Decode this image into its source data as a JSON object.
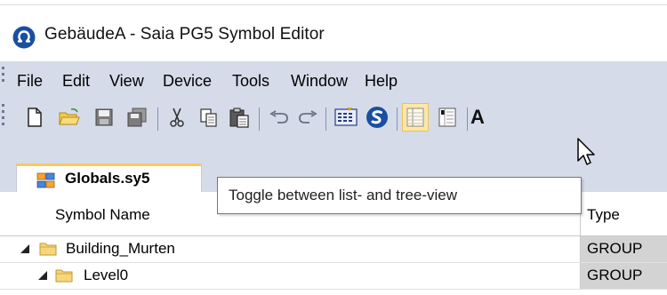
{
  "window": {
    "title": "GebäudeA - Saia PG5 Symbol Editor",
    "icon": "saia-logo-icon"
  },
  "menubar": {
    "items": [
      {
        "label": "File"
      },
      {
        "label": "Edit"
      },
      {
        "label": "View"
      },
      {
        "label": "Device"
      },
      {
        "label": "Tools"
      },
      {
        "label": "Window"
      },
      {
        "label": "Help"
      }
    ]
  },
  "toolbar": {
    "buttons": [
      {
        "icon": "new-document-icon"
      },
      {
        "icon": "open-folder-icon"
      },
      {
        "icon": "save-icon"
      },
      {
        "icon": "save-all-icon"
      },
      {
        "icon": "cut-icon"
      },
      {
        "icon": "copy-icon"
      },
      {
        "icon": "paste-icon"
      },
      {
        "icon": "undo-icon"
      },
      {
        "icon": "redo-icon"
      },
      {
        "icon": "build-icon"
      },
      {
        "icon": "saia-s-icon"
      },
      {
        "icon": "list-view-icon",
        "pressed": true
      },
      {
        "icon": "tree-view-icon"
      },
      {
        "icon": "font-icon",
        "label": "A"
      }
    ]
  },
  "tab": {
    "label": "Globals.sy5",
    "icon": "symbol-file-icon"
  },
  "tooltip": {
    "text": "Toggle between list- and tree-view"
  },
  "grid": {
    "columns": [
      "Symbol Name",
      "Type"
    ],
    "rows": [
      {
        "name": "Building_Murten",
        "type": "GROUP",
        "expanded": true
      },
      {
        "name": "Level0",
        "type": "GROUP",
        "expanded": true
      }
    ]
  },
  "colors": {
    "chrome": "#d6dbe9",
    "tab_accent": "#f5cc5a",
    "type_cell": "#d3d3d3",
    "pressed_button": "#ffe8a6"
  }
}
